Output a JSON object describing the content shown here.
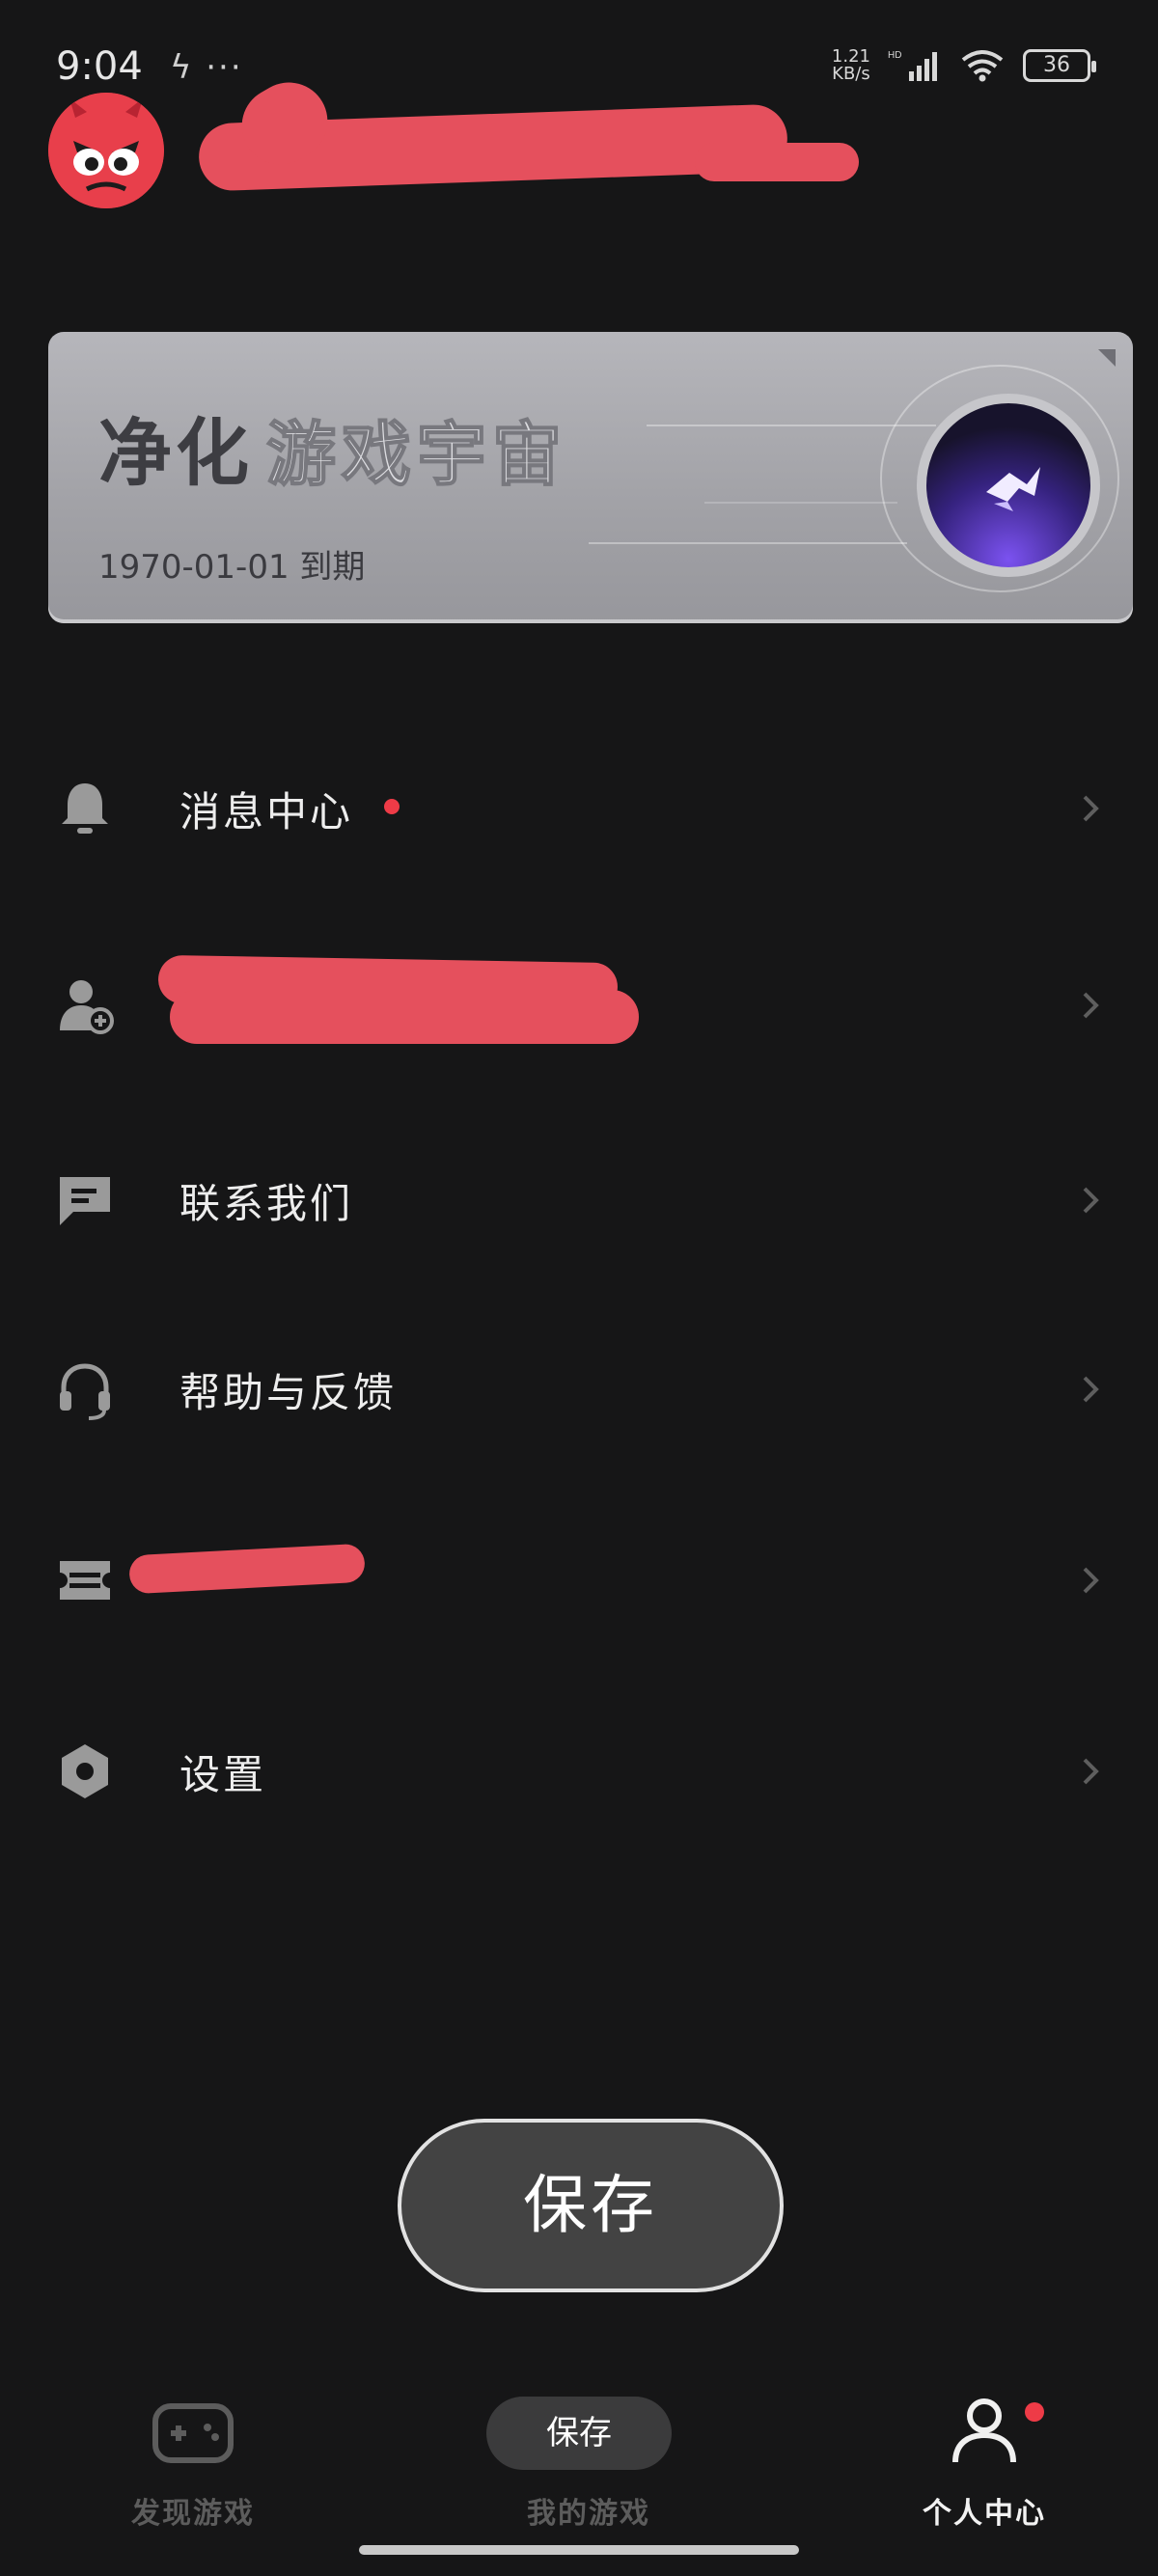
{
  "status_bar": {
    "time": "9:04",
    "extra_icons": "ϟ ···",
    "net_speed": "1.21\nKB/s",
    "network": "HD",
    "battery": "36"
  },
  "header": {
    "avatar_icon": "angry-red-face-icon",
    "username_redacted": true
  },
  "member_card": {
    "title_main": "净化",
    "title_sub": "游戏宇宙",
    "expiry": "1970-01-01 到期",
    "badge_icon": "purple-tag-badge-icon"
  },
  "menu": {
    "items": [
      {
        "label": "消息中心",
        "icon": "bell-icon",
        "has_dot": true
      },
      {
        "label": "",
        "icon": "add-user-icon",
        "redacted": true
      },
      {
        "label": "联系我们",
        "icon": "chat-bubble-icon"
      },
      {
        "label": "帮助与反馈",
        "icon": "headset-icon"
      },
      {
        "label": "",
        "icon": "ticket-icon",
        "redacted": true
      },
      {
        "label": "设置",
        "icon": "hexagon-settings-icon"
      }
    ]
  },
  "save_button": {
    "label": "保存"
  },
  "tab_bar": {
    "tabs": [
      {
        "label": "发现游戏",
        "icon": "gamepad-icon",
        "active": false
      },
      {
        "label": "我的游戏",
        "active": false
      },
      {
        "label": "个人中心",
        "icon": "person-icon",
        "active": true,
        "has_dot": true
      }
    ],
    "save_chip": "保存"
  },
  "colors": {
    "background": "#161617",
    "accent_red": "#ee3b47",
    "redaction": "#e5505d",
    "card_gray": "#a7a7ac"
  }
}
